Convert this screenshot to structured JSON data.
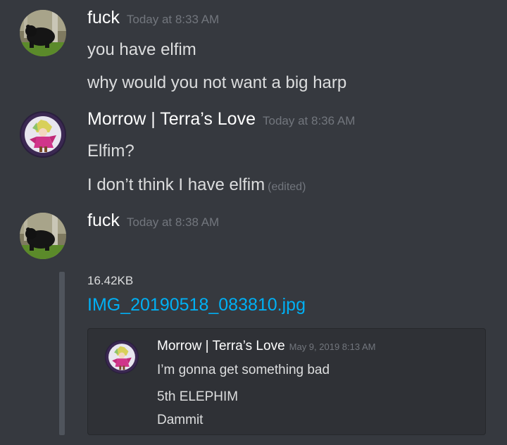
{
  "messages": [
    {
      "author": "fuck",
      "timestamp": "Today at 8:33 AM",
      "avatar": "bear-avatar-icon",
      "lines": [
        "you have elfim",
        "why would you not want a big harp"
      ]
    },
    {
      "author": "Morrow | Terra’s Love",
      "timestamp": "Today at 8:36 AM",
      "avatar": "anime-character-avatar-icon",
      "lines": [
        "Elfim?",
        "I don’t think I have elfim"
      ],
      "edited_label": "(edited)"
    },
    {
      "author": "fuck",
      "timestamp": "Today at 8:38 AM",
      "avatar": "bear-avatar-icon",
      "attachment": {
        "size": "16.42KB",
        "filename": "IMG_20190518_083810.jpg",
        "quoted": {
          "author": "Morrow | Terra’s Love",
          "timestamp": "May 9, 2019 8:13 AM",
          "lines": [
            "I’m gonna get something bad",
            "5th ELEPHIM",
            "Dammit"
          ]
        }
      }
    }
  ],
  "colors": {
    "background": "#36393f",
    "embed_background": "#2f3136",
    "embed_bar": "#4f545c",
    "username": "#ffffff",
    "message_text": "#dcddde",
    "timestamp": "#72767d",
    "link": "#00b0f4"
  }
}
